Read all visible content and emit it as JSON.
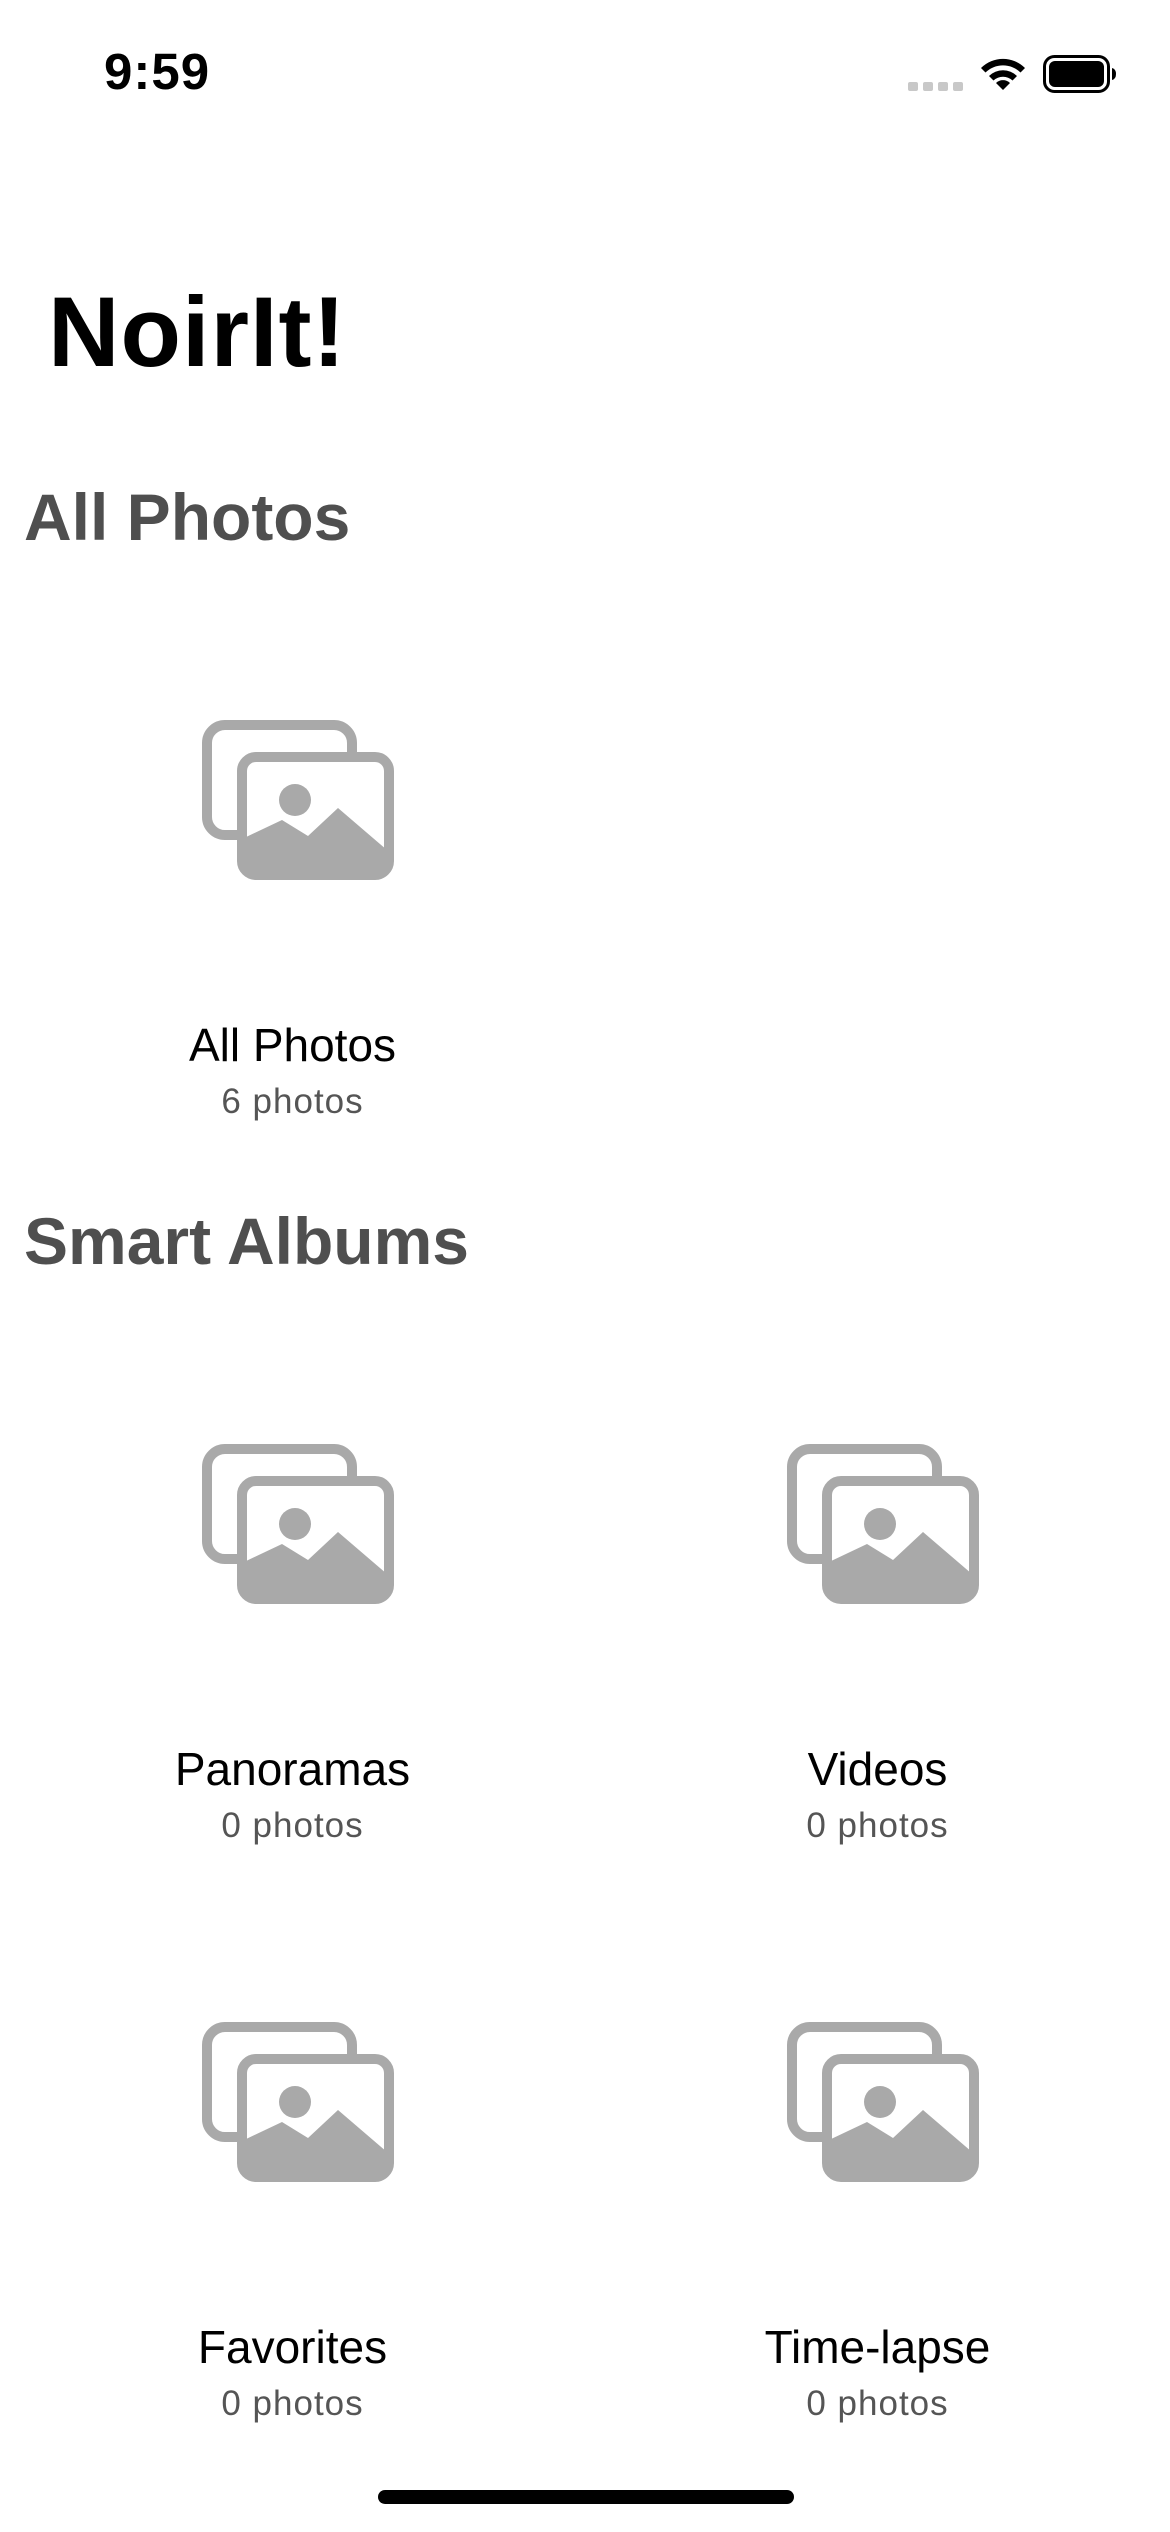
{
  "status_bar": {
    "time": "9:59",
    "icons": [
      "cellular-signal-icon",
      "wifi-icon",
      "battery-icon"
    ]
  },
  "app": {
    "title": "NoirIt!"
  },
  "sections": {
    "all_photos": {
      "title": "All Photos",
      "albums": [
        {
          "name": "All Photos",
          "count": "6 photos",
          "icon": "photo-stack-icon"
        }
      ]
    },
    "smart_albums": {
      "title": "Smart Albums",
      "albums": [
        {
          "name": "Panoramas",
          "count": "0 photos",
          "icon": "photo-stack-icon"
        },
        {
          "name": "Videos",
          "count": "0 photos",
          "icon": "photo-stack-icon"
        },
        {
          "name": "Favorites",
          "count": "0 photos",
          "icon": "photo-stack-icon"
        },
        {
          "name": "Time-lapse",
          "count": "0 photos",
          "icon": "photo-stack-icon"
        }
      ]
    }
  },
  "colors": {
    "icon_gray": "#a9a9a9",
    "section_title": "#4f4f4f",
    "subtitle": "#555555",
    "background": "#ffffff"
  }
}
